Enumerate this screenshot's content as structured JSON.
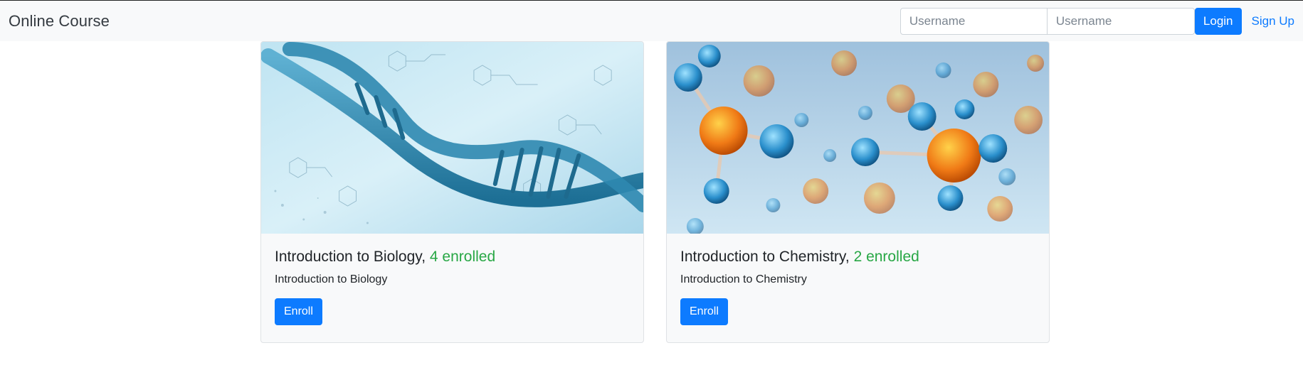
{
  "navbar": {
    "brand": "Online Course",
    "username_placeholder": "Username",
    "password_placeholder": "Username",
    "login_label": "Login",
    "signup_label": "Sign Up"
  },
  "courses": [
    {
      "title": "Introduction to Biology,",
      "enrolled": "4 enrolled",
      "description": "Introduction to Biology",
      "button": "Enroll",
      "image": "dna-helix-image"
    },
    {
      "title": "Introduction to Chemistry,",
      "enrolled": "2 enrolled",
      "description": "Introduction to Chemistry",
      "button": "Enroll",
      "image": "molecules-image"
    }
  ],
  "colors": {
    "primary": "#0d7bff",
    "success": "#28a745",
    "navbar_bg": "#f8f9fa"
  }
}
